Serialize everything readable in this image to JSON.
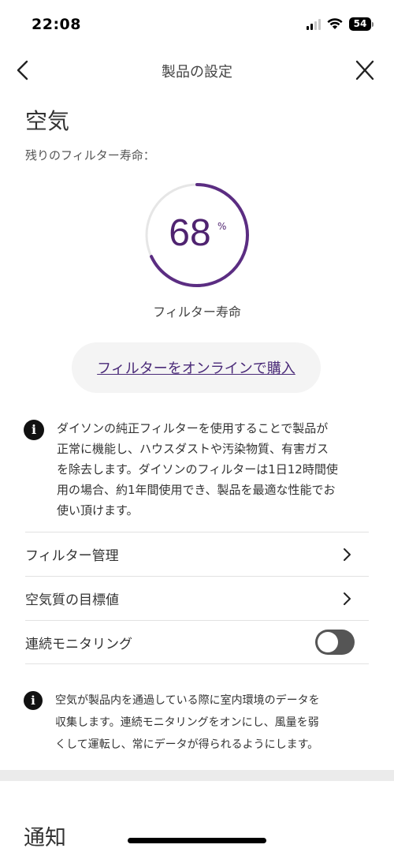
{
  "status_bar": {
    "time": "22:08",
    "battery": "54"
  },
  "nav": {
    "title": "製品の設定"
  },
  "air": {
    "title": "空気",
    "filter_life_label": "残りのフィルター寿命：",
    "filter_life_percent": 68,
    "filter_life_value": "68",
    "filter_life_unit": "%",
    "gauge_caption": "フィルター寿命",
    "gauge_color": "#5b2d82",
    "gauge_track_color": "#e6e6e6"
  },
  "buy_button": {
    "label": "フィルターをオンラインで購入"
  },
  "info_filter": {
    "icon": "info-icon",
    "line1": "ダイソンの純正フィルターを使用することで製品が",
    "line2": "正常に機能し、ハウスダストや汚染物質、有害ガス",
    "line3": "を除去します。ダイソンのフィルターは1日12時間使",
    "line4": "用の場合、約1年間使用でき、製品を最適な性能でお",
    "line5": "使い頂けます。"
  },
  "menu": {
    "filter_management": "フィルター管理",
    "air_quality_target": "空気質の目標値",
    "continuous_monitoring": "連続モニタリング",
    "continuous_monitoring_on": false
  },
  "info_monitoring": {
    "icon": "info-icon",
    "line1": "空気が製品内を通過している際に室内環境のデータを",
    "line2": "収集します。連続モニタリングをオンにし、風量を弱",
    "line3": "くして運転し、常にデータが得られるようにします。"
  },
  "notifications": {
    "title": "通知"
  }
}
